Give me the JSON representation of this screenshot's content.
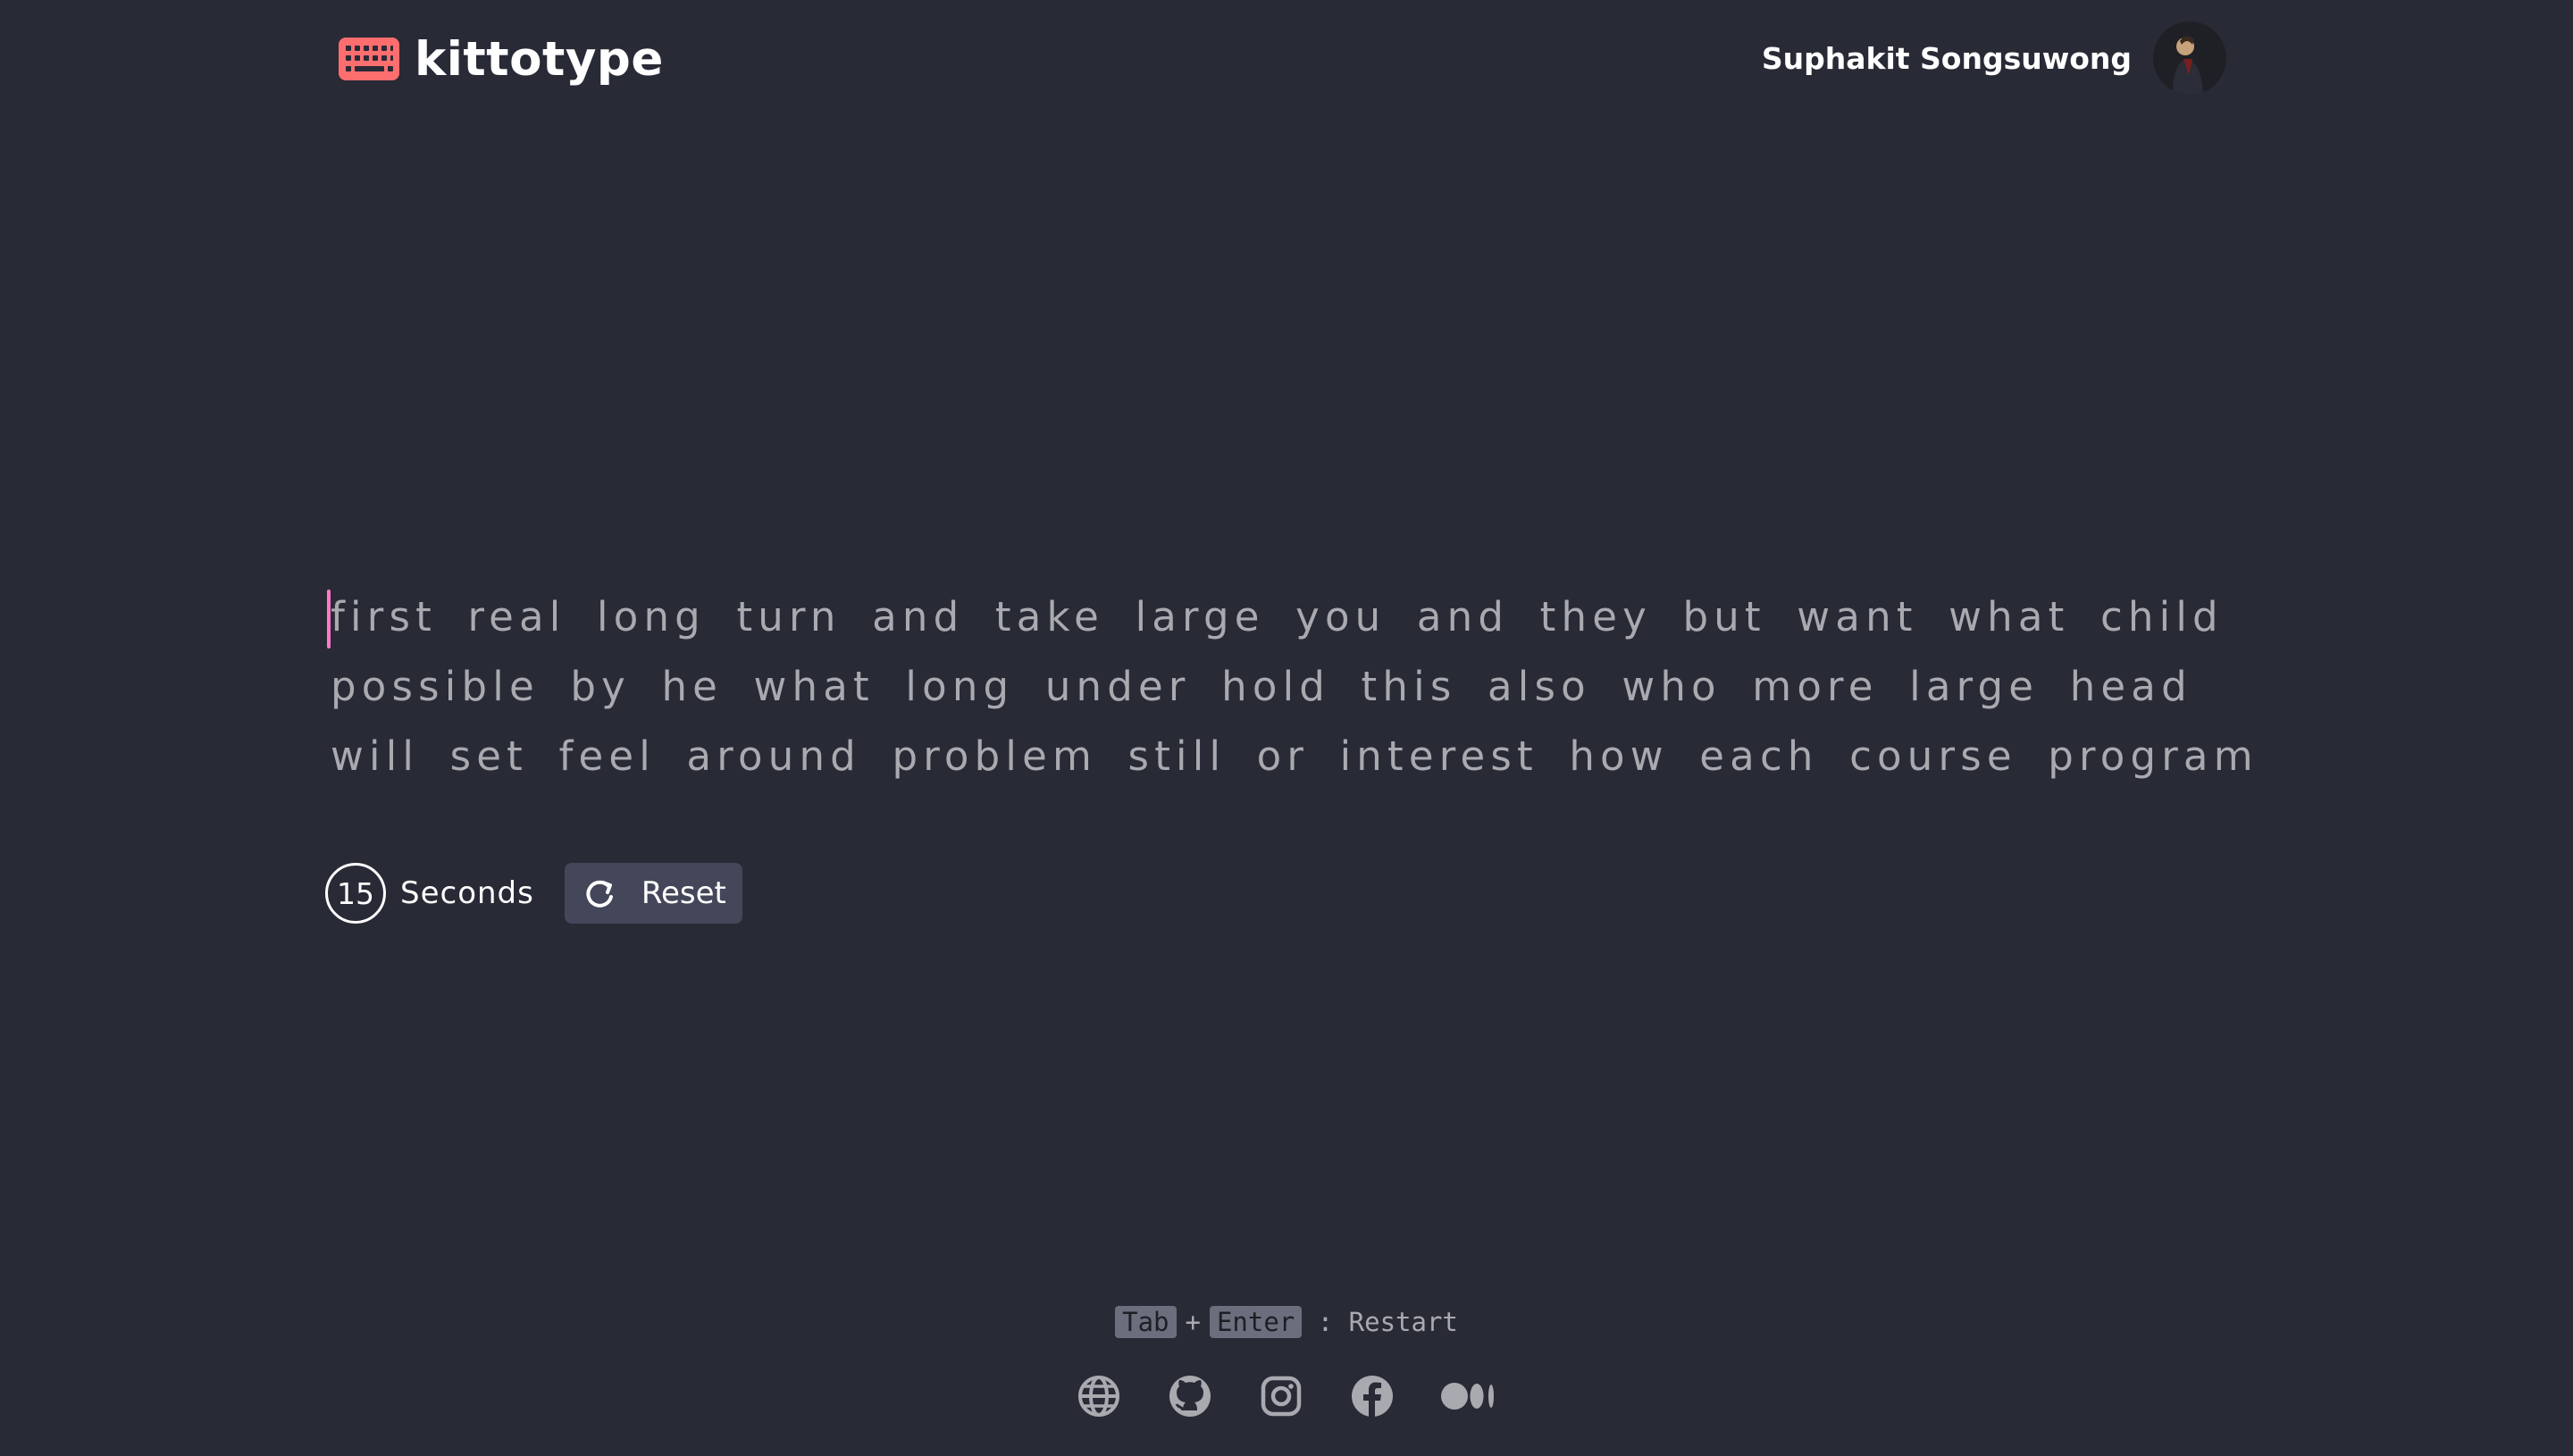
{
  "header": {
    "brand": "kittotype",
    "brand_color": "#ff6e6e",
    "user_name": "Suphakit Songsuwong"
  },
  "typing": {
    "lines": [
      "first real long turn and take large you and they but want what child",
      "possible by he what long under hold this also who more large head",
      "will set feel around problem still or interest how each course program"
    ],
    "caret_color": "#ff79c6"
  },
  "controls": {
    "time": "15",
    "time_unit": "Seconds",
    "reset_label": "Reset"
  },
  "hint": {
    "key1": "Tab",
    "plus": "+",
    "key2": "Enter",
    "action": ": Restart"
  },
  "socials": [
    "globe-icon",
    "github-icon",
    "instagram-icon",
    "facebook-icon",
    "medium-icon"
  ],
  "colors": {
    "background": "#282a36",
    "text_muted": "#a9aab0",
    "button_bg": "#44475a"
  }
}
